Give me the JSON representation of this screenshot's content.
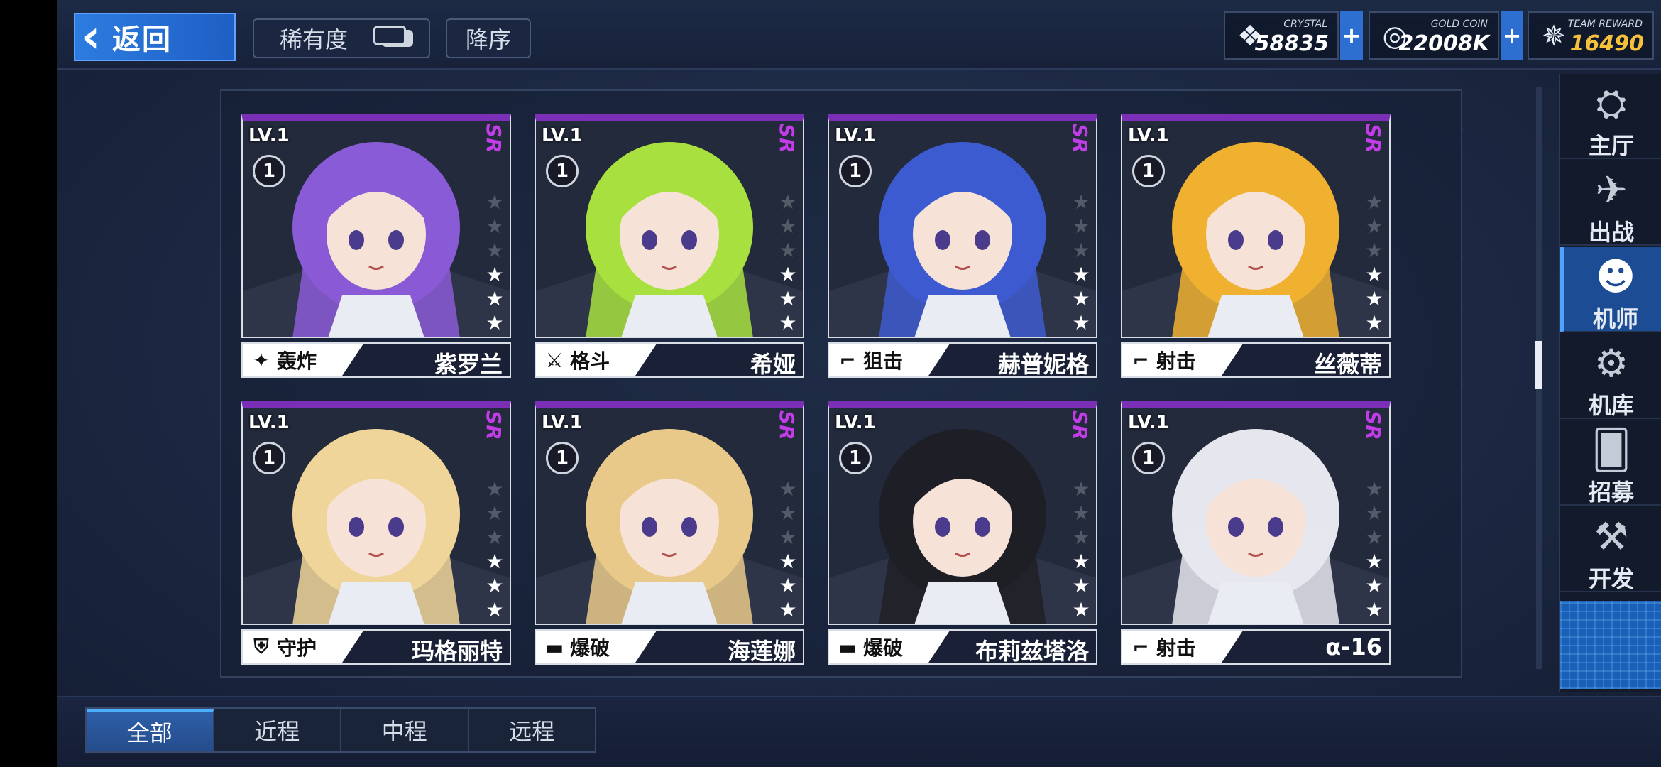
{
  "header": {
    "back_label": "返回",
    "rarity_label": "稀有度",
    "sort_label": "降序"
  },
  "currency": {
    "crystal": {
      "caption": "CRYSTAL",
      "value": "58835"
    },
    "gold": {
      "caption": "GOLD COIN",
      "value": "22008K"
    },
    "reward": {
      "caption": "TEAM REWARD",
      "value": "16490"
    },
    "plus": "+"
  },
  "cards": [
    {
      "level": "LV.1",
      "badge": "1",
      "rarity": "SR",
      "role": "轰炸",
      "name": "紫罗兰",
      "stars": 3
    },
    {
      "level": "LV.1",
      "badge": "1",
      "rarity": "SR",
      "role": "格斗",
      "name": "希娅",
      "stars": 3
    },
    {
      "level": "LV.1",
      "badge": "1",
      "rarity": "SR",
      "role": "狙击",
      "name": "赫普妮格",
      "stars": 3
    },
    {
      "level": "LV.1",
      "badge": "1",
      "rarity": "SR",
      "role": "射击",
      "name": "丝薇蒂",
      "stars": 3
    },
    {
      "level": "LV.1",
      "badge": "1",
      "rarity": "SR",
      "role": "守护",
      "name": "玛格丽特",
      "stars": 3
    },
    {
      "level": "LV.1",
      "badge": "1",
      "rarity": "SR",
      "role": "爆破",
      "name": "海莲娜",
      "stars": 3
    },
    {
      "level": "LV.1",
      "badge": "1",
      "rarity": "SR",
      "role": "爆破",
      "name": "布莉兹塔洛",
      "stars": 3
    },
    {
      "level": "LV.1",
      "badge": "1",
      "rarity": "SR",
      "role": "射击",
      "name": "α-16",
      "stars": 3
    }
  ],
  "nav": [
    {
      "label": "主厅",
      "icon": "hall-icon"
    },
    {
      "label": "出战",
      "icon": "sortie-icon"
    },
    {
      "label": "机师",
      "icon": "pilot-icon"
    },
    {
      "label": "机库",
      "icon": "hangar-icon"
    },
    {
      "label": "招募",
      "icon": "recruit-icon"
    },
    {
      "label": "开发",
      "icon": "develop-icon"
    }
  ],
  "tabs": [
    "全部",
    "近程",
    "中程",
    "远程"
  ],
  "theme": {
    "accent": "#2d7ce0",
    "sr_color": "#c23ce8",
    "rarity_bar": "#7a2fb6",
    "reward_color": "#f6c13a"
  }
}
